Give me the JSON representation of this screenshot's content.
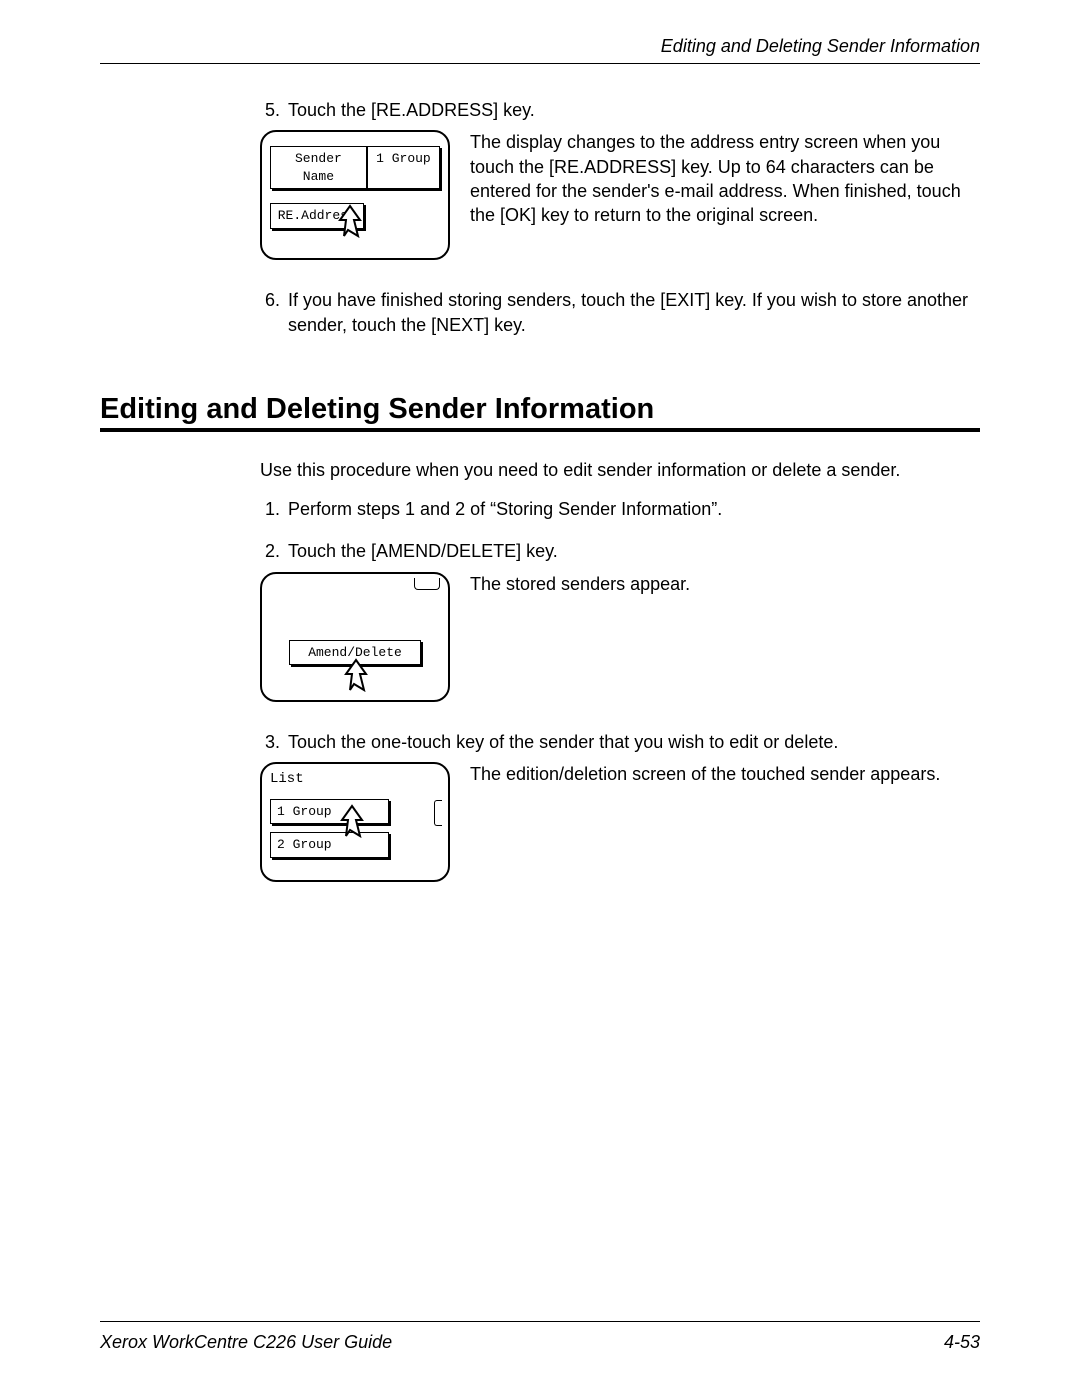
{
  "runningHead": "Editing and Deleting Sender Information",
  "stepsA": [
    {
      "n": "5.",
      "text": "Touch the [RE.ADDRESS] key."
    }
  ],
  "panel1": {
    "senderName": "Sender Name",
    "group": "1 Group",
    "reAddress": "RE.Address"
  },
  "caption1": "The display changes to the address entry screen when you touch the [RE.ADDRESS] key. Up to 64 characters can be entered for the sender's e-mail address. When finished, touch the [OK] key to return to the original screen.",
  "step6": {
    "n": "6.",
    "text": "If you have finished storing senders, touch the [EXIT] key. If you wish to store another sender, touch the [NEXT] key."
  },
  "heading": "Editing and Deleting Sender Information",
  "intro": "Use this procedure when you need to edit sender information or delete a sender.",
  "stepsB": [
    {
      "n": "1.",
      "text": "Perform steps 1 and 2 of “Storing Sender Information”."
    },
    {
      "n": "2.",
      "text": "Touch the [AMEND/DELETE] key."
    }
  ],
  "panel2": {
    "amend": "Amend/Delete"
  },
  "caption2": "The stored senders appear.",
  "step3": {
    "n": "3.",
    "text": "Touch the one-touch key of the sender that you wish to edit or delete."
  },
  "panel3": {
    "listLabel": "List",
    "item1": "1 Group",
    "item2": "2 Group"
  },
  "caption3": "The edition/deletion screen of the touched sender appears.",
  "footerLeft": "Xerox WorkCentre C226 User Guide",
  "footerRight": "4-53"
}
